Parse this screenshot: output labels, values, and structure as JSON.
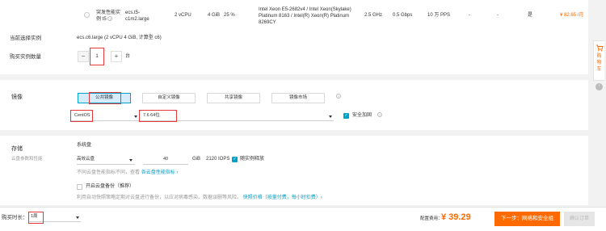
{
  "instance_row": {
    "type": "突发性能实例 t5",
    "spec": "ecs.t5-c1m2.large",
    "vcpu": "2 vCPU",
    "memory": "4 GiB",
    "baseline": "25 %",
    "processor": "Intel Xeon E5-2682v4 / Intel Xeon(Skylake) Platinum 8163 / Intel(R) Xeon(R) Platinum 8269CY",
    "clock": "2.5 GHz",
    "bandwidth": "0.5 Gbps",
    "pps": "10 万 PPS",
    "ipv6": "-",
    "dash2": "-",
    "supported": "是",
    "price": "¥ 82.65 /月"
  },
  "selected_instance": {
    "label": "当前选择实例",
    "value": "ecs.c6.large (2 vCPU 4 GiB, 计算型 c6)"
  },
  "quantity": {
    "label": "购买实例数量",
    "minus": "−",
    "value": "1",
    "plus": "+",
    "unit": "台"
  },
  "image": {
    "label": "镜像",
    "tabs": [
      "公共镜像",
      "自定义镜像",
      "共享镜像",
      "镜像市场"
    ],
    "os": "CentOS",
    "version": "7.6 64位",
    "security_label": "安全加固"
  },
  "storage": {
    "label": "存储",
    "sublabel": "云盘参数和性能",
    "system_disk_label": "系统盘",
    "disk_type": "高效云盘",
    "size": "40",
    "unit": "GiB",
    "iops": "2120 IOPS",
    "release_label": "随实例释放",
    "perf_note_prefix": "不同云盘性能指标不同，查看",
    "perf_note_link": "各云盘性能指标 ›",
    "backup_label": "开启云盘备份（推荐）",
    "backup_note": "利用自动快照策略定期对云盘进行备份，以应对病毒感染、数据误删等风险。",
    "backup_link": "快照价格（按量付费，每小时扣费）›"
  },
  "side_cart": {
    "chars": [
      "购",
      "物",
      "车"
    ],
    "up": "↑"
  },
  "footer": {
    "duration_label": "购买时长：",
    "duration_value": "1周",
    "fee_label": "配置费用：",
    "fee_value": "¥ 39.29",
    "next_button": "下一步：网络和安全组",
    "confirm_button": "确认订单"
  },
  "colors": {
    "accent": "#00a2ca",
    "orange": "#ff6a00",
    "highlight": "#e4393c"
  }
}
